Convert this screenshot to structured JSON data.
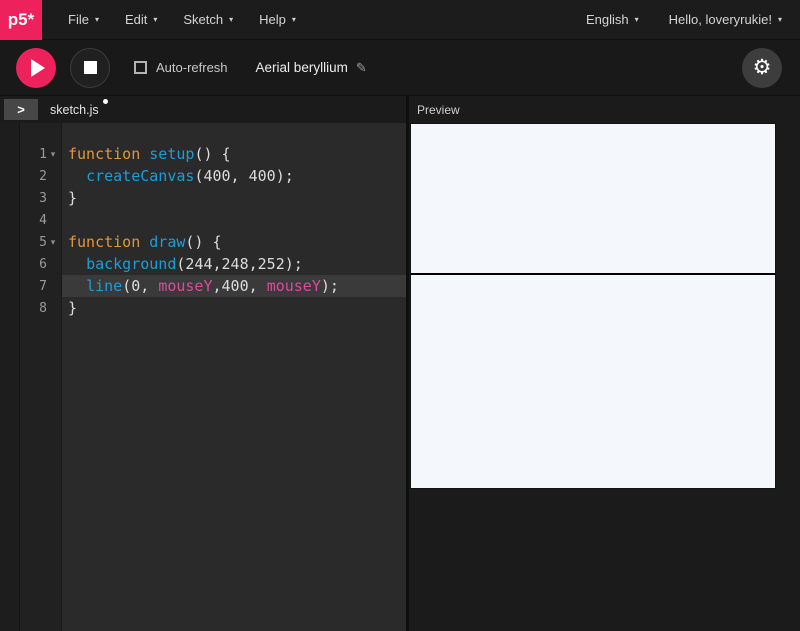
{
  "colors": {
    "accent": "#ed225d",
    "keyword": "#e2953f",
    "function_name": "#1c9dd8",
    "special_variable": "#de4a9b",
    "canvas_background": "#f4f8fc",
    "canvas_line": "#000000"
  },
  "header": {
    "logo_text": "p5*",
    "menus": [
      {
        "label": "File"
      },
      {
        "label": "Edit"
      },
      {
        "label": "Sketch"
      },
      {
        "label": "Help"
      }
    ],
    "language_selector": "English",
    "account_label": "Hello, loveryrukie!"
  },
  "toolbar": {
    "autorefresh_label": "Auto-refresh",
    "autorefresh_checked": false,
    "sketch_name": "Aerial beryllium"
  },
  "editor": {
    "tab_label": "sketch.js",
    "unsaved": true,
    "lines": [
      {
        "num": "1",
        "fold": true,
        "active": false,
        "segments": [
          {
            "t": "function",
            "c": "k"
          },
          {
            "t": " ",
            "c": "p"
          },
          {
            "t": "setup",
            "c": "f"
          },
          {
            "t": "() {",
            "c": "p"
          }
        ]
      },
      {
        "num": "2",
        "fold": false,
        "active": false,
        "segments": [
          {
            "t": "  ",
            "c": "p"
          },
          {
            "t": "createCanvas",
            "c": "f"
          },
          {
            "t": "(400, 400);",
            "c": "p"
          }
        ]
      },
      {
        "num": "3",
        "fold": false,
        "active": false,
        "segments": [
          {
            "t": "}",
            "c": "p"
          }
        ]
      },
      {
        "num": "4",
        "fold": false,
        "active": false,
        "segments": []
      },
      {
        "num": "5",
        "fold": true,
        "active": false,
        "segments": [
          {
            "t": "function",
            "c": "k"
          },
          {
            "t": " ",
            "c": "p"
          },
          {
            "t": "draw",
            "c": "f"
          },
          {
            "t": "() {",
            "c": "p"
          }
        ]
      },
      {
        "num": "6",
        "fold": false,
        "active": false,
        "segments": [
          {
            "t": "  ",
            "c": "p"
          },
          {
            "t": "background",
            "c": "f"
          },
          {
            "t": "(244,248,252);",
            "c": "p"
          }
        ]
      },
      {
        "num": "7",
        "fold": false,
        "active": true,
        "segments": [
          {
            "t": "  ",
            "c": "p"
          },
          {
            "t": "line",
            "c": "f"
          },
          {
            "t": "(0, ",
            "c": "p"
          },
          {
            "t": "mouseY",
            "c": "v"
          },
          {
            "t": ",400, ",
            "c": "p"
          },
          {
            "t": "mouseY",
            "c": "v"
          },
          {
            "t": ");",
            "c": "p"
          }
        ]
      },
      {
        "num": "8",
        "fold": false,
        "active": false,
        "segments": [
          {
            "t": "}",
            "c": "p"
          }
        ]
      }
    ]
  },
  "preview": {
    "label": "Preview",
    "line_y_percent": 41
  }
}
